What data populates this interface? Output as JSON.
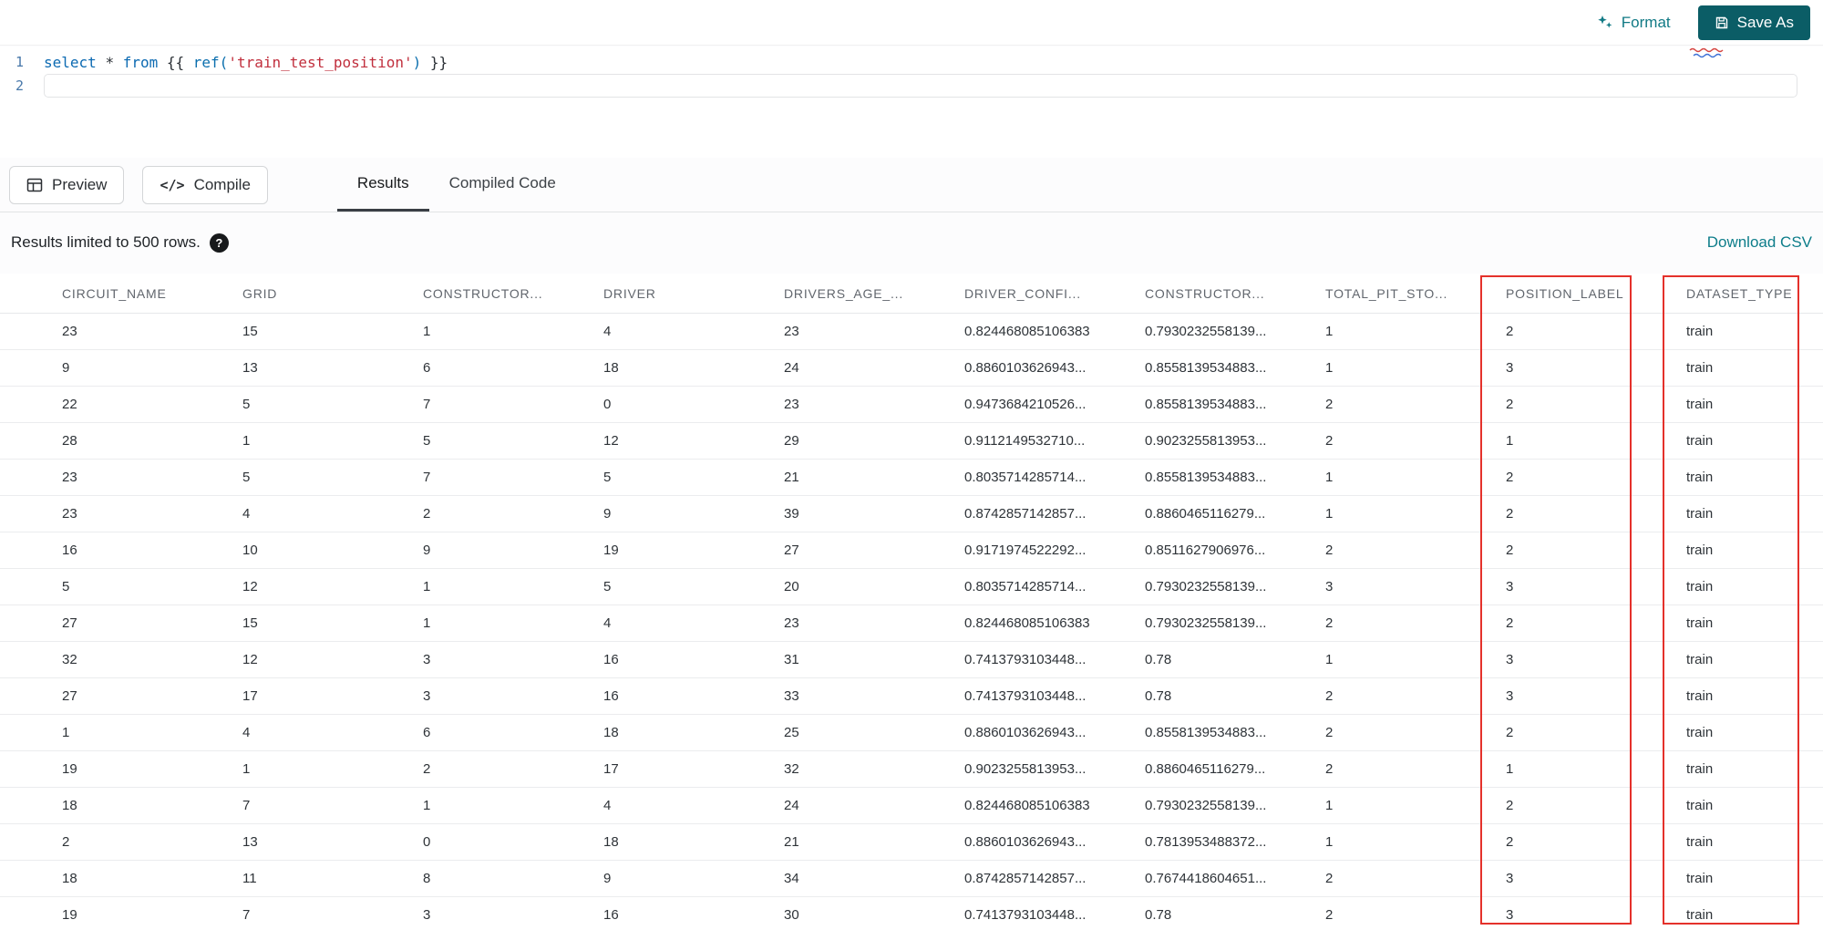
{
  "toolbar": {
    "format": "Format",
    "save_as": "Save As"
  },
  "editor": {
    "line_numbers": [
      "1",
      "2"
    ],
    "code_tokens": [
      {
        "text": "select",
        "type": "keyword"
      },
      {
        "text": " ",
        "type": "operator"
      },
      {
        "text": "*",
        "type": "operator"
      },
      {
        "text": " ",
        "type": "operator"
      },
      {
        "text": "from",
        "type": "keyword"
      },
      {
        "text": " {{ ",
        "type": "jinja"
      },
      {
        "text": "ref(",
        "type": "function"
      },
      {
        "text": "'train_test_position'",
        "type": "string"
      },
      {
        "text": ")",
        "type": "function"
      },
      {
        "text": " }}",
        "type": "jinja"
      }
    ]
  },
  "actions": {
    "preview": "Preview",
    "compile": "Compile"
  },
  "tabs": [
    {
      "label": "Results",
      "active": true
    },
    {
      "label": "Compiled Code",
      "active": false
    }
  ],
  "results": {
    "limit_text": "Results limited to 500 rows.",
    "help_glyph": "?",
    "download_csv": "Download CSV"
  },
  "table": {
    "columns": [
      "CIRCUIT_NAME",
      "GRID",
      "CONSTRUCTOR...",
      "DRIVER",
      "DRIVERS_AGE_...",
      "DRIVER_CONFI...",
      "CONSTRUCTOR...",
      "TOTAL_PIT_STO...",
      "POSITION_LABEL",
      "DATASET_TYPE"
    ],
    "highlighted_columns": [
      "POSITION_LABEL",
      "DATASET_TYPE"
    ],
    "rows": [
      [
        "23",
        "15",
        "1",
        "4",
        "23",
        "0.824468085106383",
        "0.7930232558139...",
        "1",
        "2",
        "train"
      ],
      [
        "9",
        "13",
        "6",
        "18",
        "24",
        "0.8860103626943...",
        "0.8558139534883...",
        "1",
        "3",
        "train"
      ],
      [
        "22",
        "5",
        "7",
        "0",
        "23",
        "0.9473684210526...",
        "0.8558139534883...",
        "2",
        "2",
        "train"
      ],
      [
        "28",
        "1",
        "5",
        "12",
        "29",
        "0.9112149532710...",
        "0.9023255813953...",
        "2",
        "1",
        "train"
      ],
      [
        "23",
        "5",
        "7",
        "5",
        "21",
        "0.8035714285714...",
        "0.8558139534883...",
        "1",
        "2",
        "train"
      ],
      [
        "23",
        "4",
        "2",
        "9",
        "39",
        "0.8742857142857...",
        "0.8860465116279...",
        "1",
        "2",
        "train"
      ],
      [
        "16",
        "10",
        "9",
        "19",
        "27",
        "0.9171974522292...",
        "0.8511627906976...",
        "2",
        "2",
        "train"
      ],
      [
        "5",
        "12",
        "1",
        "5",
        "20",
        "0.8035714285714...",
        "0.7930232558139...",
        "3",
        "3",
        "train"
      ],
      [
        "27",
        "15",
        "1",
        "4",
        "23",
        "0.824468085106383",
        "0.7930232558139...",
        "2",
        "2",
        "train"
      ],
      [
        "32",
        "12",
        "3",
        "16",
        "31",
        "0.7413793103448...",
        "0.78",
        "1",
        "3",
        "train"
      ],
      [
        "27",
        "17",
        "3",
        "16",
        "33",
        "0.7413793103448...",
        "0.78",
        "2",
        "3",
        "train"
      ],
      [
        "1",
        "4",
        "6",
        "18",
        "25",
        "0.8860103626943...",
        "0.8558139534883...",
        "2",
        "2",
        "train"
      ],
      [
        "19",
        "1",
        "2",
        "17",
        "32",
        "0.9023255813953...",
        "0.8860465116279...",
        "2",
        "1",
        "train"
      ],
      [
        "18",
        "7",
        "1",
        "4",
        "24",
        "0.824468085106383",
        "0.7930232558139...",
        "1",
        "2",
        "train"
      ],
      [
        "2",
        "13",
        "0",
        "18",
        "21",
        "0.8860103626943...",
        "0.7813953488372...",
        "1",
        "2",
        "train"
      ],
      [
        "18",
        "11",
        "8",
        "9",
        "34",
        "0.8742857142857...",
        "0.7674418604651...",
        "2",
        "3",
        "train"
      ],
      [
        "19",
        "7",
        "3",
        "16",
        "30",
        "0.7413793103448...",
        "0.78",
        "2",
        "3",
        "train"
      ]
    ]
  },
  "colors": {
    "accent_teal": "#117a85",
    "save_button_bg": "#0b5d66",
    "highlight_red": "#e4312b",
    "keyword_blue": "#0c6ab2",
    "string_red": "#c12f3d"
  }
}
